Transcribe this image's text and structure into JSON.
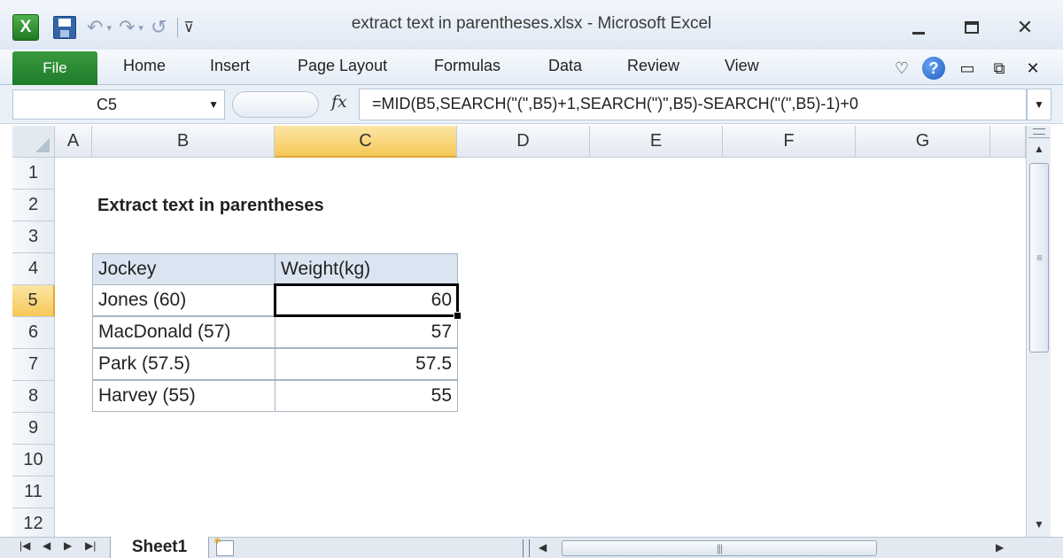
{
  "window": {
    "title": "extract text in parentheses.xlsx  -  Microsoft Excel",
    "app_icon_letter": "X"
  },
  "quick_access": {
    "undo_glyph": "↶",
    "redo_glyph": "↷",
    "repeat_glyph": "↺",
    "caret": "▾",
    "more_glyph": "⊽"
  },
  "window_controls": {
    "close_glyph": "✕"
  },
  "ribbon": {
    "file_label": "File",
    "tabs": [
      "Home",
      "Insert",
      "Page Layout",
      "Formulas",
      "Data",
      "Review",
      "View"
    ],
    "right_glyphs": {
      "ribbon_toggle": "♡",
      "help": "?",
      "min": "▭",
      "restore": "⧉",
      "close": "✕"
    }
  },
  "formula_bar": {
    "name_box": "C5",
    "fx": "fx",
    "formula": "=MID(B5,SEARCH(\"(\",B5)+1,SEARCH(\")\",B5)-SEARCH(\"(\",B5)-1)+0",
    "dropdown": "▼",
    "expand": "▼"
  },
  "sheet": {
    "columns": [
      "A",
      "B",
      "C",
      "D",
      "E",
      "F",
      "G"
    ],
    "selected_column": "C",
    "rows": [
      "1",
      "2",
      "3",
      "4",
      "5",
      "6",
      "7",
      "8",
      "9",
      "10",
      "11",
      "12"
    ],
    "selected_row": "5",
    "title": "Extract text in parentheses",
    "table": {
      "headers": [
        "Jockey",
        "Weight(kg)"
      ],
      "rows": [
        [
          "Jones (60)",
          "60"
        ],
        [
          "MacDonald (57)",
          "57"
        ],
        [
          "Park (57.5)",
          "57.5"
        ],
        [
          "Harvey (55)",
          "55"
        ]
      ]
    },
    "active_cell": "C5"
  },
  "scrollbars": {
    "up": "▲",
    "down": "▼",
    "left": "◀",
    "right": "▶",
    "grip_v": "≡",
    "grip_h": "|||"
  },
  "sheet_tabs": {
    "nav": [
      "|◀",
      "◀",
      "▶",
      "▶|"
    ],
    "tabs": [
      "Sheet1"
    ]
  },
  "colors": {
    "file_tab": "#1e7b2a",
    "selected_header": "#f6c957",
    "table_header_fill": "#dbe5f1"
  }
}
